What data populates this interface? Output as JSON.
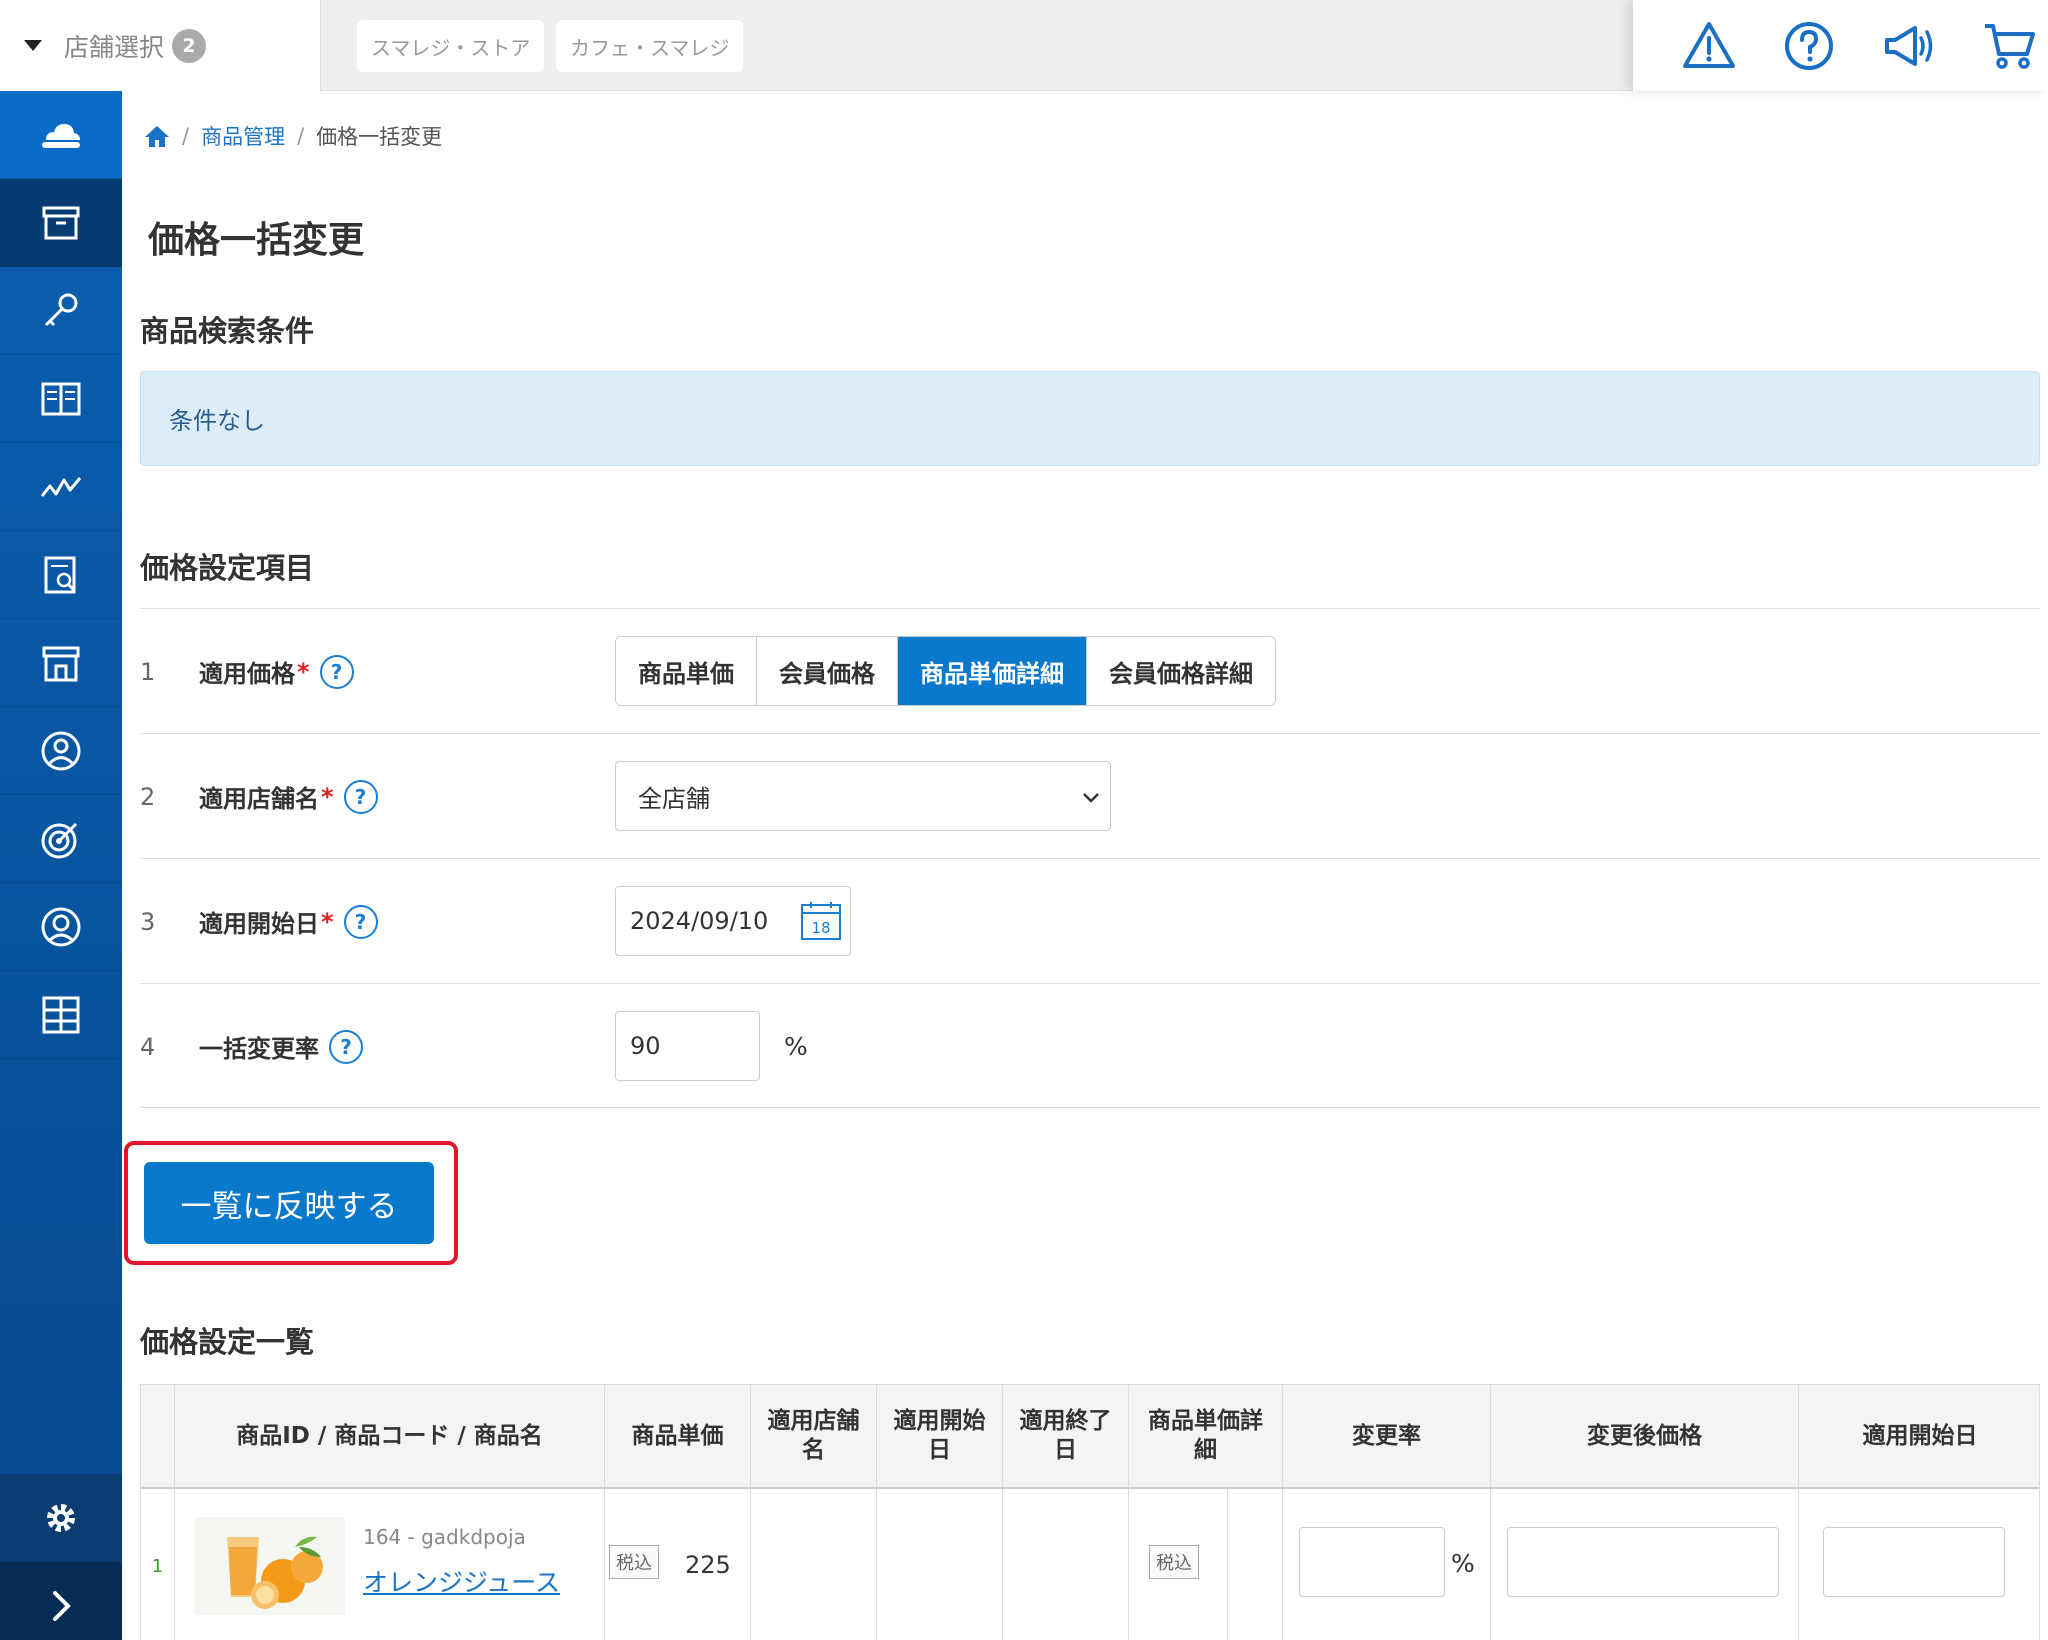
{
  "topbar": {
    "store_select_label": "店舗選択",
    "store_count": "2",
    "stores": [
      "スマレジ・ストア",
      "カフェ・スマレジ"
    ],
    "icons": [
      "warning-icon",
      "help-icon",
      "megaphone-icon",
      "cart-icon"
    ]
  },
  "sidebar": {
    "items": [
      "cloud-icon",
      "archive-icon",
      "key-icon",
      "book-icon",
      "chart-icon",
      "report-icon",
      "store-icon",
      "customer-icon",
      "target-icon",
      "staff-icon",
      "apps-icon"
    ],
    "bottom": [
      "settings-icon",
      "expand-icon"
    ]
  },
  "breadcrumb": {
    "home_icon": "home-icon",
    "parent": "商品管理",
    "current": "価格一括変更"
  },
  "page_title": "価格一括変更",
  "search": {
    "title": "商品検索条件",
    "conditions": "条件なし"
  },
  "settings": {
    "title": "価格設定項目",
    "rows": [
      {
        "num": "1",
        "label": "適用価格",
        "required": "*"
      },
      {
        "num": "2",
        "label": "適用店舗名",
        "required": "*"
      },
      {
        "num": "3",
        "label": "適用開始日",
        "required": "*"
      },
      {
        "num": "4",
        "label": "一括変更率",
        "required": ""
      }
    ],
    "help_glyph": "?",
    "price_types": [
      "商品単価",
      "会員価格",
      "商品単価詳細",
      "会員価格詳細"
    ],
    "price_type_selected": "商品単価詳細",
    "store_value": "全店舗",
    "start_date": "2024/09/10",
    "calendar_day": "18",
    "rate": "90",
    "rate_unit": "%"
  },
  "reflect_button": "一覧に反映する",
  "list": {
    "title": "価格設定一覧",
    "headers": [
      "",
      "商品ID / 商品コード / 商品名",
      "商品単価",
      "適用店舗名",
      "適用開始日",
      "適用終了日",
      "商品単価詳細",
      "変更率",
      "変更後価格",
      "適用開始日"
    ],
    "rows": [
      {
        "num": "1",
        "code": "164 - gadkdpoja",
        "name": "オレンジジュース",
        "tax_label": "税込",
        "unit_price": "225",
        "detail_tax_label": "税込",
        "rate_unit": "%"
      }
    ]
  },
  "colors": {
    "primary": "#0a79cc",
    "sidebar": "#0a5fb0",
    "highlight": "#e4142a",
    "condition_bg": "#dcedf7"
  }
}
